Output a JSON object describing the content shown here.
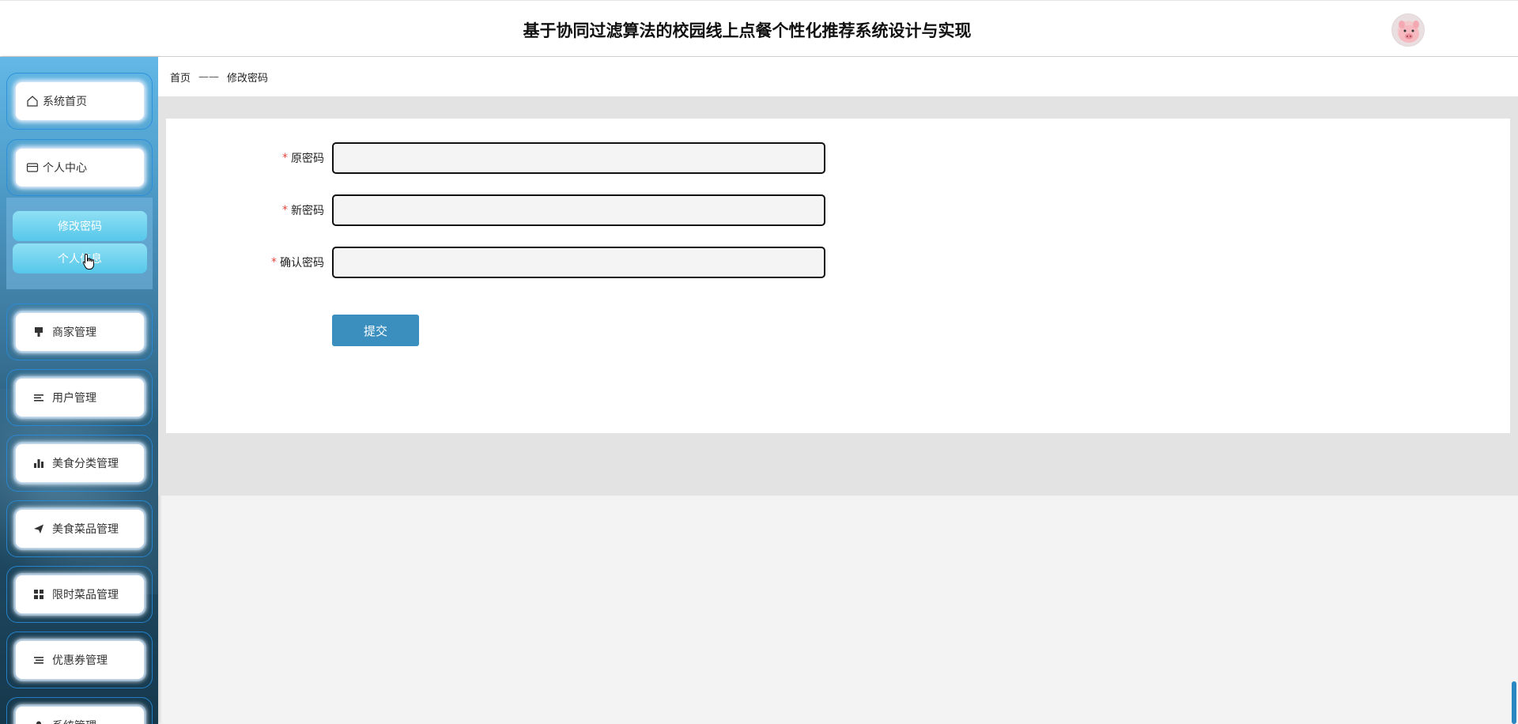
{
  "header": {
    "title": "基于协同过滤算法的校园线上点餐个性化推荐系统设计与实现",
    "avatar_icon": "pig-avatar-icon"
  },
  "sidebar": {
    "items": [
      {
        "label": "系统首页",
        "icon": "home-icon"
      },
      {
        "label": "个人中心",
        "icon": "card-icon"
      },
      {
        "label": "商家管理",
        "icon": "shop-icon"
      },
      {
        "label": "用户管理",
        "icon": "list-icon"
      },
      {
        "label": "美食分类管理",
        "icon": "bar-chart-icon"
      },
      {
        "label": "美食菜品管理",
        "icon": "send-icon"
      },
      {
        "label": "限时菜品管理",
        "icon": "grid-icon"
      },
      {
        "label": "优惠券管理",
        "icon": "list-icon"
      },
      {
        "label": "系统管理",
        "icon": "user-icon"
      }
    ],
    "submenu": [
      {
        "label": "修改密码"
      },
      {
        "label": "个人信息"
      }
    ]
  },
  "breadcrumb": {
    "home": "首页",
    "separator": "——",
    "current": "修改密码"
  },
  "form": {
    "fields": [
      {
        "required_mark": "*",
        "label": "原密码",
        "value": ""
      },
      {
        "required_mark": "*",
        "label": "新密码",
        "value": ""
      },
      {
        "required_mark": "*",
        "label": "确认密码",
        "value": ""
      }
    ],
    "submit_label": "提交"
  },
  "colors": {
    "accent": "#3a8fbf",
    "submenu_item": "#56c7ea",
    "required": "#e2473d"
  }
}
